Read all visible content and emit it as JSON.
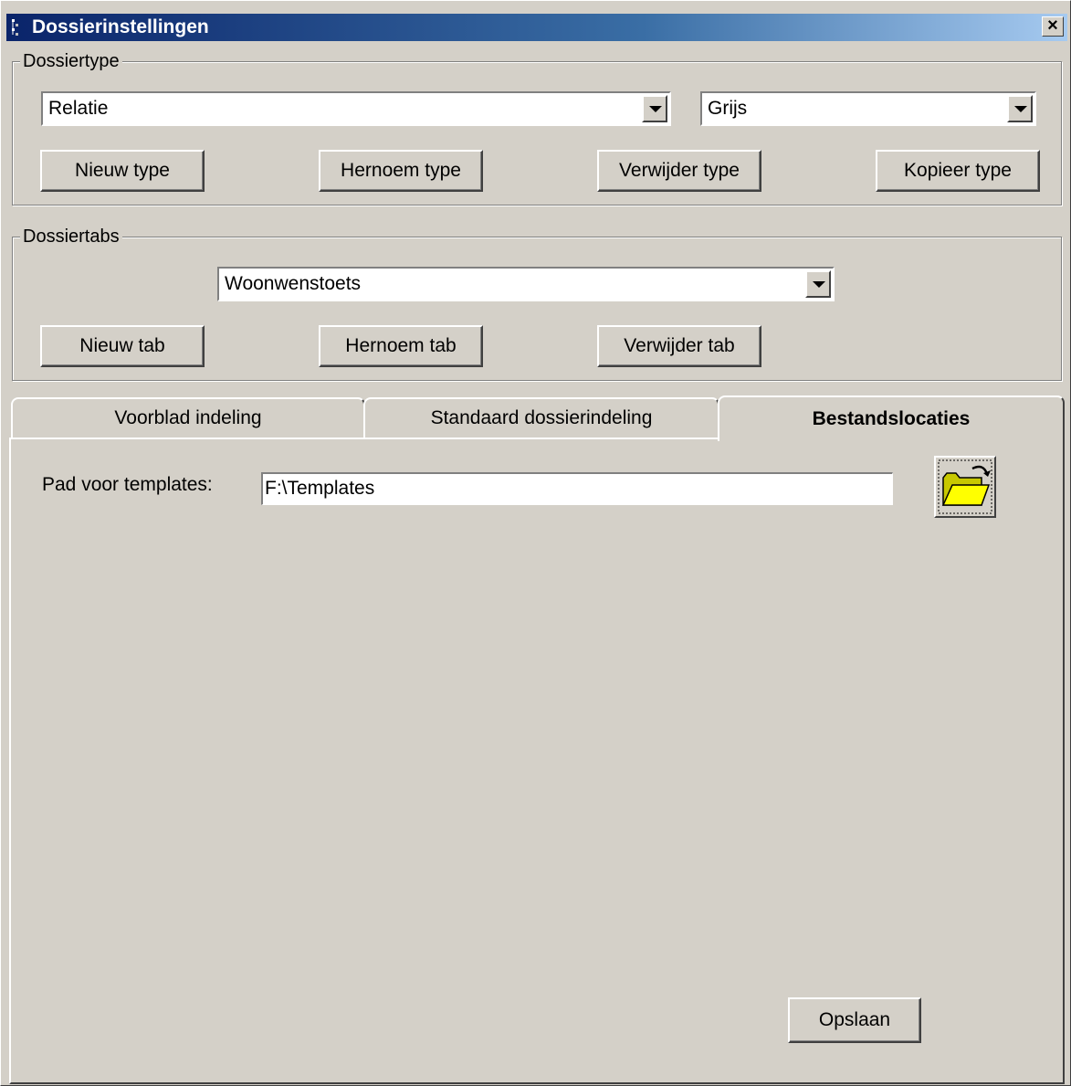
{
  "window": {
    "title": "Dossierinstellingen",
    "close_glyph": "×"
  },
  "dossiertype": {
    "group_label": "Dossiertype",
    "type_select": {
      "value": "Relatie"
    },
    "color_select": {
      "value": "Grijs"
    },
    "buttons": {
      "new": "Nieuw type",
      "rename": "Hernoem type",
      "delete": "Verwijder type",
      "copy": "Kopieer type"
    }
  },
  "dossiertabs": {
    "group_label": "Dossiertabs",
    "tab_select": {
      "value": "Woonwenstoets"
    },
    "buttons": {
      "new": "Nieuw tab",
      "rename": "Hernoem tab",
      "delete": "Verwijder tab"
    }
  },
  "tabs": [
    {
      "label": "Voorblad indeling",
      "active": false
    },
    {
      "label": "Standaard dossierindeling",
      "active": false
    },
    {
      "label": "Bestandslocaties",
      "active": true
    }
  ],
  "bestandslocaties": {
    "template_path_label": "Pad voor templates:",
    "template_path_value": "F:\\Templates",
    "browse_icon": "open-folder-icon",
    "save_label": "Opslaan"
  },
  "colors": {
    "face": "#d4d0c8",
    "titlebar_start": "#0a246a",
    "titlebar_end": "#a6caf0",
    "folder_yellow": "#ffff00"
  }
}
